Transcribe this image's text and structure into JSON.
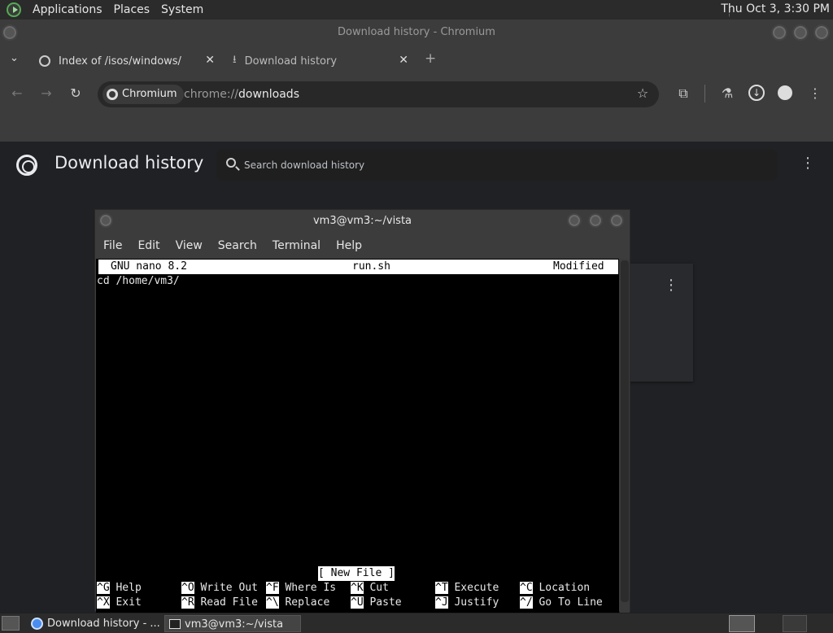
{
  "top_panel": {
    "menus": [
      "Applications",
      "Places",
      "System"
    ],
    "clock": "Thu Oct  3, 3:30 PM"
  },
  "chromium": {
    "window_title": "Download history - Chromium",
    "tabs": [
      {
        "label": "Index of /isos/windows/"
      },
      {
        "label": "Download history"
      }
    ],
    "omnibox": {
      "chip": "Chromium",
      "url_prefix": "chrome://",
      "url_path": "downloads"
    }
  },
  "downloads_page": {
    "title": "Download history",
    "search_placeholder": "Search download history"
  },
  "terminal": {
    "title": "vm3@vm3:~/vista",
    "menu": [
      "File",
      "Edit",
      "View",
      "Search",
      "Terminal",
      "Help"
    ],
    "nano": {
      "version": "GNU nano 8.2",
      "filename": "run.sh",
      "state": "Modified",
      "lines": [
        "cd /home/vm3/"
      ],
      "status": "[ New File ]",
      "shortcuts_row1": [
        {
          "key": "^G",
          "label": "Help"
        },
        {
          "key": "^O",
          "label": "Write Out"
        },
        {
          "key": "^F",
          "label": "Where Is"
        },
        {
          "key": "^K",
          "label": "Cut"
        },
        {
          "key": "^T",
          "label": "Execute"
        },
        {
          "key": "^C",
          "label": "Location"
        }
      ],
      "shortcuts_row2": [
        {
          "key": "^X",
          "label": "Exit"
        },
        {
          "key": "^R",
          "label": "Read File"
        },
        {
          "key": "^\\",
          "label": "Replace"
        },
        {
          "key": "^U",
          "label": "Paste"
        },
        {
          "key": "^J",
          "label": "Justify"
        },
        {
          "key": "^/",
          "label": "Go To Line"
        }
      ]
    }
  },
  "taskbar": {
    "items": [
      "Download history - ...",
      "vm3@vm3:~/vista"
    ]
  }
}
